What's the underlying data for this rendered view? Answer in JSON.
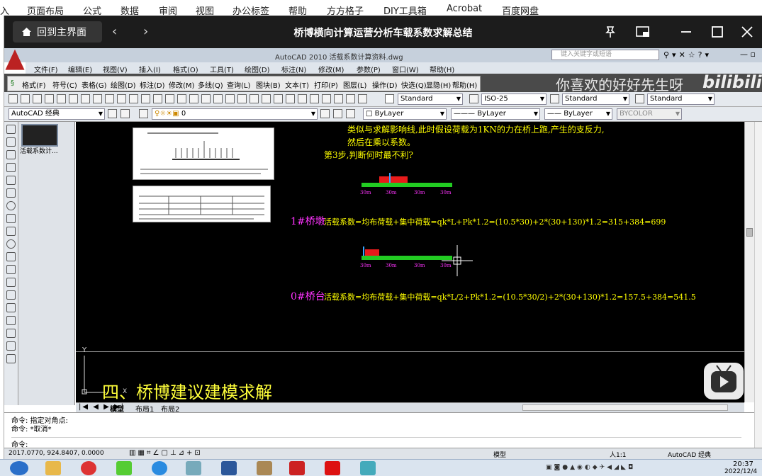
{
  "excel": {
    "ribbon": [
      "入",
      "页面布局",
      "公式",
      "数据",
      "审阅",
      "视图",
      "办公标签",
      "帮助",
      "方方格子",
      "DIY工具箱",
      "Acrobat",
      "百度网盘"
    ]
  },
  "player": {
    "home_label": "回到主界面",
    "back_icon": "‹",
    "forward_icon": "›",
    "title": "桥博横向计算运营分析车载系数求解总结"
  },
  "cad": {
    "title": "AutoCAD 2010    活载系数计算资料.dwg",
    "search_placeholder": "键入关键字或短语",
    "menu": [
      "文件(F)",
      "编辑(E)",
      "视图(V)",
      "插入(I)",
      "格式(O)",
      "工具(T)",
      "绘图(D)",
      "标注(N)",
      "修改(M)",
      "参数(P)",
      "窗口(W)",
      "帮助(H)"
    ],
    "toolbar2": [
      "格式(F)",
      "符号(C)",
      "表格(G)",
      "绘图(D)",
      "标注(D)",
      "修改(M)",
      "多线(Q)",
      "查询(L)",
      "图块(B)",
      "文本(T)",
      "打印(P)",
      "图层(L)",
      "操作(D)",
      "快选(Q)",
      "显隐(H)",
      "帮助(H)"
    ],
    "watermark": "你喜欢的好好先生呀",
    "bili": "bilibili",
    "styles": {
      "text": "Standard",
      "dim": "ISO-25",
      "table": "Standard",
      "mleader": "Standard"
    },
    "workspace": "AutoCAD 经典",
    "layer": "0",
    "color": "ByLayer",
    "linetype": "ByLayer",
    "lineweight": "ByLayer",
    "plotstyle": "BYCOLOR",
    "panel_label": "活载系数计...",
    "canvas": {
      "line1": "类似与求解影响线,此时假设荷载为1KN的力在桥上跑,产生的支反力,",
      "line2": "然后在乘以系数。",
      "step3": "第3步,判断何时最不利?",
      "pier_label": "1#桥墩",
      "pier_formula": "活载系数=均布荷载+集中荷载=qk*L+Pk*1.2=(10.5*30)+2*(30+130)*1.2=315+384=699",
      "abut_label": "0#桥台",
      "abut_formula": "活载系数=均布荷载+集中荷载=qk*L/2+Pk*1.2=(10.5*30/2)+2*(30+130)*1.2=157.5+384=541.5",
      "section_title": "四、桥博建议建模求解",
      "axis_y": "Y",
      "axis_x": "X",
      "span_label": "30m"
    },
    "tabs": [
      "模型",
      "布局1",
      "布局2"
    ],
    "command": [
      "命令: 指定对角点:",
      "命令: *取消*",
      "命令:"
    ],
    "coords": "2017.0770, 924.8407, 0.0000",
    "status_right": "模型",
    "scale": "人1:1",
    "workspace_status": "AutoCAD 经典"
  },
  "taskbar": {
    "time": "20:37",
    "date": "2022/12/4"
  }
}
